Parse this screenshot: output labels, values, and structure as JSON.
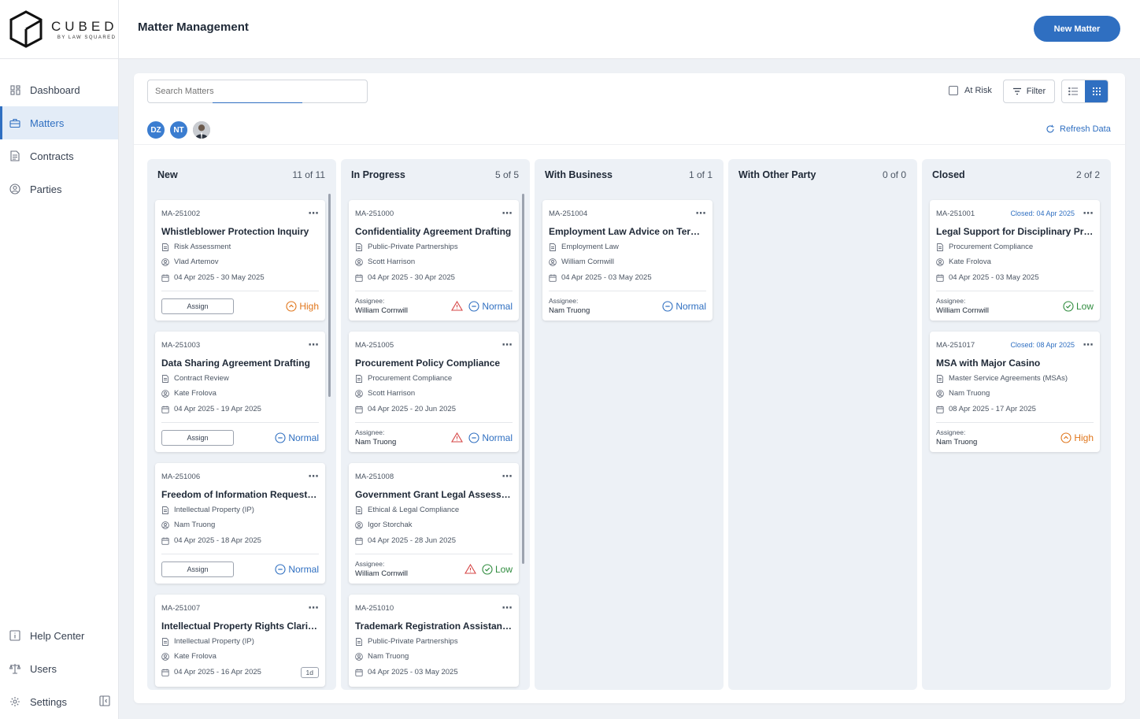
{
  "brand": {
    "name": "CUBED",
    "sub": "BY LAW SQUARED"
  },
  "sidebar": {
    "items": [
      {
        "label": "Dashboard",
        "icon": "dashboard-icon"
      },
      {
        "label": "Matters",
        "icon": "briefcase-icon",
        "active": true
      },
      {
        "label": "Contracts",
        "icon": "document-icon"
      },
      {
        "label": "Parties",
        "icon": "user-circle-icon"
      }
    ],
    "bottom": [
      {
        "label": "Help Center",
        "icon": "info-icon"
      },
      {
        "label": "Users",
        "icon": "scales-icon"
      },
      {
        "label": "Settings",
        "icon": "gear-icon"
      }
    ]
  },
  "header": {
    "title": "Matter Management",
    "new_button": "New Matter"
  },
  "toolbar": {
    "search_placeholder": "Search Matters",
    "at_risk_label": "At Risk",
    "filter_label": "Filter",
    "refresh_label": "Refresh Data",
    "avatars": [
      "DZ",
      "NT"
    ]
  },
  "colors": {
    "accent": "#2f6fc1",
    "high": "#e0761c",
    "normal": "#2f6fc1",
    "low": "#2e8b3d",
    "risk": "#d64545"
  },
  "columns": [
    {
      "title": "New",
      "count": "11 of 11",
      "cards": [
        {
          "id": "MA-251002",
          "title": "Whistleblower Protection Inquiry",
          "category": "Risk Assessment",
          "person": "Vlad Artemov",
          "dates": "04 Apr 2025 - 30 May 2025",
          "assign": "Assign",
          "priority": "High"
        },
        {
          "id": "MA-251003",
          "title": "Data Sharing Agreement Drafting",
          "category": "Contract Review",
          "person": "Kate Frolova",
          "dates": "04 Apr 2025 - 19 Apr 2025",
          "assign": "Assign",
          "priority": "Normal"
        },
        {
          "id": "MA-251006",
          "title": "Freedom of Information Request Re...",
          "category": "Intellectual Property (IP)",
          "person": "Nam Truong",
          "dates": "04 Apr 2025 - 18 Apr 2025",
          "assign": "Assign",
          "priority": "Normal"
        },
        {
          "id": "MA-251007",
          "title": "Intellectual Property Rights Clarific...",
          "category": "Intellectual Property (IP)",
          "person": "Kate Frolova",
          "dates": "04 Apr 2025 - 16 Apr 2025",
          "tag": "1d"
        }
      ]
    },
    {
      "title": "In Progress",
      "count": "5 of 5",
      "cards": [
        {
          "id": "MA-251000",
          "title": "Confidentiality Agreement Drafting",
          "category": "Public-Private Partnerships",
          "person": "Scott Harrison",
          "dates": "04 Apr 2025 - 30 Apr 2025",
          "assignee_label": "Assignee:",
          "assignee": "William Cornwill",
          "priority": "Normal",
          "at_risk": true
        },
        {
          "id": "MA-251005",
          "title": "Procurement Policy Compliance",
          "category": "Procurement Compliance",
          "person": "Scott Harrison",
          "dates": "04 Apr 2025 - 20 Jun 2025",
          "assignee_label": "Assignee:",
          "assignee": "Nam Truong",
          "priority": "Normal",
          "at_risk": true
        },
        {
          "id": "MA-251008",
          "title": "Government Grant Legal Assessment",
          "category": "Ethical & Legal Compliance",
          "person": "Igor Storchak",
          "dates": "04 Apr 2025 - 28 Jun 2025",
          "assignee_label": "Assignee:",
          "assignee": "William Cornwill",
          "priority": "Low",
          "at_risk": true
        },
        {
          "id": "MA-251010",
          "title": "Trademark Registration Assistance",
          "category": "Public-Private Partnerships",
          "person": "Nam Truong",
          "dates": "04 Apr 2025 - 03 May 2025"
        }
      ]
    },
    {
      "title": "With Business",
      "count": "1 of 1",
      "cards": [
        {
          "id": "MA-251004",
          "title": "Employment Law Advice on Termin...",
          "category": "Employment Law",
          "person": "William Cornwill",
          "dates": "04 Apr 2025 - 03 May 2025",
          "assignee_label": "Assignee:",
          "assignee": "Nam Truong",
          "priority": "Normal"
        }
      ]
    },
    {
      "title": "With Other Party",
      "count": "0 of 0",
      "cards": []
    },
    {
      "title": "Closed",
      "count": "2 of 2",
      "cards": [
        {
          "id": "MA-251001",
          "closed": "Closed: 04 Apr 2025",
          "title": "Legal Support for Disciplinary Proc...",
          "category": "Procurement Compliance",
          "person": "Kate Frolova",
          "dates": "04 Apr 2025 - 03 May 2025",
          "assignee_label": "Assignee:",
          "assignee": "William Cornwill",
          "priority": "Low"
        },
        {
          "id": "MA-251017",
          "closed": "Closed: 08 Apr 2025",
          "title": "MSA with Major Casino",
          "category": "Master Service Agreements (MSAs)",
          "person": "Nam Truong",
          "dates": "08 Apr 2025 - 17 Apr 2025",
          "assignee_label": "Assignee:",
          "assignee": "Nam Truong",
          "priority": "High"
        }
      ]
    }
  ]
}
